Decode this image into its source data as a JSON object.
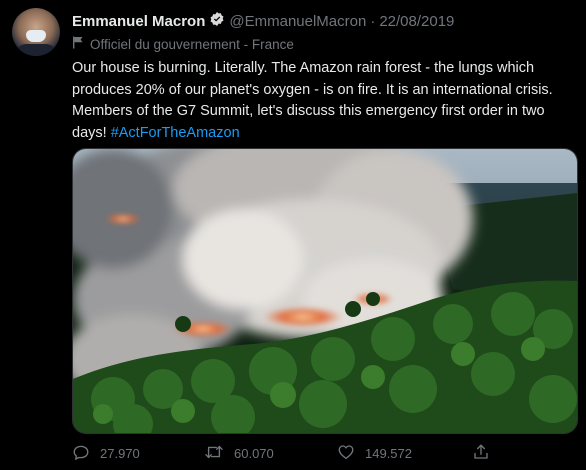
{
  "tweet": {
    "author_name": "Emmanuel Macron",
    "handle": "@EmmanuelMacron",
    "separator": "·",
    "date": "22/08/2019",
    "affiliation": "Officiel du gouvernement - France",
    "text_main": "Our house is burning. Literally. The Amazon rain forest - the lungs which produces 20% of our planet's oxygen - is on fire. It is an international crisis. Members of the G7 Summit, let's discuss this emergency first order in two days! ",
    "hashtag": "#ActForTheAmazon"
  },
  "actions": {
    "replies": "27.970",
    "retweets": "60.070",
    "likes": "149.572"
  },
  "icons": {
    "verified": "verified-badge-icon",
    "affiliation": "flag-icon",
    "reply": "reply-icon",
    "retweet": "retweet-icon",
    "like": "heart-icon",
    "share": "share-icon"
  },
  "colors": {
    "background": "#000000",
    "text": "#e7e9ea",
    "muted": "#71767b",
    "link": "#1d9bf0"
  }
}
